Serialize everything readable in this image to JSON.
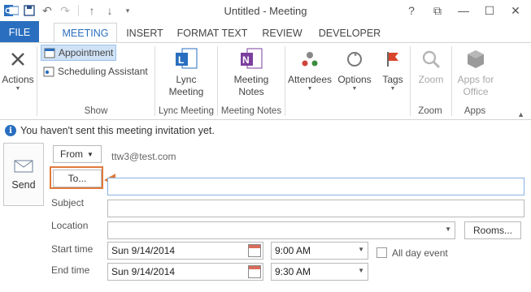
{
  "window": {
    "title": "Untitled - Meeting",
    "controls": [
      "?",
      "⧉",
      "—",
      "☐",
      "✕"
    ]
  },
  "qat": [
    "save-icon",
    "undo-icon",
    "redo-icon",
    "up-icon",
    "down-icon",
    "customize-icon"
  ],
  "tabs": [
    "FILE",
    "MEETING",
    "INSERT",
    "FORMAT TEXT",
    "REVIEW",
    "DEVELOPER"
  ],
  "ribbon": {
    "actions": "Actions",
    "appointment": "Appointment",
    "scheduling": "Scheduling Assistant",
    "show_group": "Show",
    "lync_line1": "Lync",
    "lync_line2": "Meeting",
    "lync_group": "Lync Meeting",
    "notes_line1": "Meeting",
    "notes_line2": "Notes",
    "notes_group": "Meeting Notes",
    "attendees": "Attendees",
    "options": "Options",
    "tags": "Tags",
    "zoom": "Zoom",
    "zoom_group": "Zoom",
    "apps_line1": "Apps for",
    "apps_line2": "Office",
    "apps_group": "Apps"
  },
  "infobar": {
    "message": "You haven't sent this meeting invitation yet."
  },
  "form": {
    "send": "Send",
    "from_button": "From",
    "from_value": "ttw3@test.com",
    "to_button": "To...",
    "to_value": "",
    "subject_label": "Subject",
    "subject_value": "",
    "location_label": "Location",
    "location_value": "",
    "rooms_button": "Rooms...",
    "start_label": "Start time",
    "start_date": "Sun 9/14/2014",
    "start_time": "9:00 AM",
    "allday_label": "All day event",
    "allday_checked": false,
    "end_label": "End time",
    "end_date": "Sun 9/14/2014",
    "end_time": "9:30 AM"
  },
  "colors": {
    "accent": "#2a6fbf",
    "highlight": "#e07a3c"
  }
}
